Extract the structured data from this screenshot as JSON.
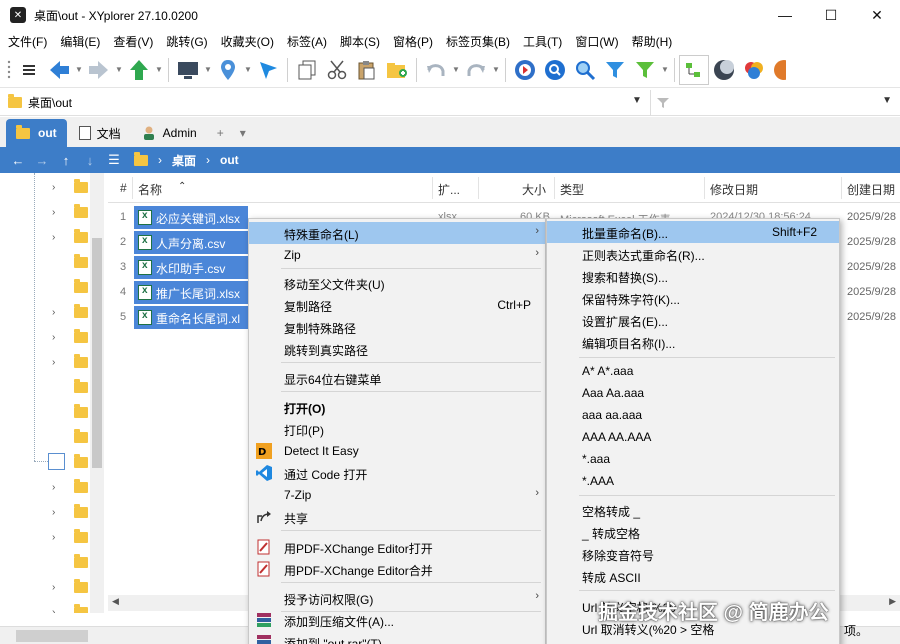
{
  "window": {
    "title": "桌面\\out - XYplorer 27.10.0200",
    "minimize": "—",
    "maximize": "☐",
    "close": "✕"
  },
  "menubar": [
    "文件(F)",
    "编辑(E)",
    "查看(V)",
    "跳转(G)",
    "收藏夹(O)",
    "标签(A)",
    "脚本(S)",
    "窗格(P)",
    "标签页集(B)",
    "工具(T)",
    "窗口(W)",
    "帮助(H)"
  ],
  "address": {
    "path": "桌面\\out"
  },
  "tabs": [
    {
      "label": "out"
    },
    {
      "label": "文档"
    },
    {
      "label": "Admin"
    }
  ],
  "tab_add": "+",
  "tab_menu": "▾",
  "breadcrumb": [
    "桌面",
    "out"
  ],
  "columns": {
    "num": "#",
    "name": "名称",
    "ext": "扩...",
    "size": "大小",
    "type": "类型",
    "modified": "修改日期",
    "created": "创建日期"
  },
  "files": [
    {
      "num": "1",
      "name": "必应关键词.xlsx",
      "ext": "xlsx",
      "size": "60 KB",
      "type": "Microsoft Excel 工作表",
      "modified": "2024/12/30 18:56:24",
      "created": "2025/9/28"
    },
    {
      "num": "2",
      "name": "人声分离.csv",
      "created": "2025/9/28"
    },
    {
      "num": "3",
      "name": "水印助手.csv",
      "created": "2025/9/28"
    },
    {
      "num": "4",
      "name": "推广长尾词.xlsx",
      "created": "2025/9/28"
    },
    {
      "num": "5",
      "name": "重命名长尾词.xl",
      "created": "2025/9/28"
    }
  ],
  "context_menu": {
    "items": [
      {
        "label": "特殊重命名(L)",
        "arrow": "›",
        "highlight": true
      },
      {
        "label": "Zip",
        "arrow": "›"
      },
      {
        "label": "移动至父文件夹(U)"
      },
      {
        "label": "复制路径",
        "shortcut": "Ctrl+P"
      },
      {
        "label": "复制特殊路径"
      },
      {
        "label": "跳转到真实路径"
      },
      {
        "label": "显示64位右键菜单"
      },
      {
        "label": "打开(O)",
        "bold": true
      },
      {
        "label": "打印(P)"
      },
      {
        "label": "Detect It Easy",
        "icon": "detect-it-easy-icon"
      },
      {
        "label": "通过 Code 打开",
        "icon": "vscode-icon"
      },
      {
        "label": "7-Zip",
        "arrow": "›"
      },
      {
        "label": "共享",
        "icon": "share-icon"
      },
      {
        "label": "用PDF-XChange Editor打开",
        "icon": "pdf-xchange-icon"
      },
      {
        "label": "用PDF-XChange Editor合并",
        "icon": "pdf-xchange-icon"
      },
      {
        "label": "授予访问权限(G)",
        "arrow": "›"
      },
      {
        "label": "添加到压缩文件(A)...",
        "icon": "winrar-icon"
      },
      {
        "label": "添加到 \"out.rar\"(T)",
        "icon": "winrar-icon"
      }
    ]
  },
  "submenu": {
    "items": [
      {
        "label": "批量重命名(B)...",
        "shortcut": "Shift+F2",
        "highlight": true
      },
      {
        "label": "正则表达式重命名(R)..."
      },
      {
        "label": "搜索和替换(S)..."
      },
      {
        "label": "保留特殊字符(K)..."
      },
      {
        "label": "设置扩展名(E)..."
      },
      {
        "label": "编辑项目名称(I)..."
      },
      {
        "label": "A* A*.aaa"
      },
      {
        "label": "Aaa Aa.aaa"
      },
      {
        "label": "aaa aa.aaa"
      },
      {
        "label": "AAA AA.AAA"
      },
      {
        "label": "*.aaa"
      },
      {
        "label": "*.AAA"
      },
      {
        "label": "空格转成 _"
      },
      {
        "label": "_ 转成空格"
      },
      {
        "label": "移除变音符号"
      },
      {
        "label": "转成 ASCII"
      },
      {
        "label": "Url 转义空格 %20"
      },
      {
        "label": "Url 取消转义(%20 > 空格"
      }
    ]
  },
  "status_right": "项。",
  "watermark": "掘金技术社区 @ 简鹿办公",
  "colors": {
    "accent": "#3d7dc8",
    "selection": "#4b86d8",
    "menu_highlight": "#9ec7ef"
  }
}
